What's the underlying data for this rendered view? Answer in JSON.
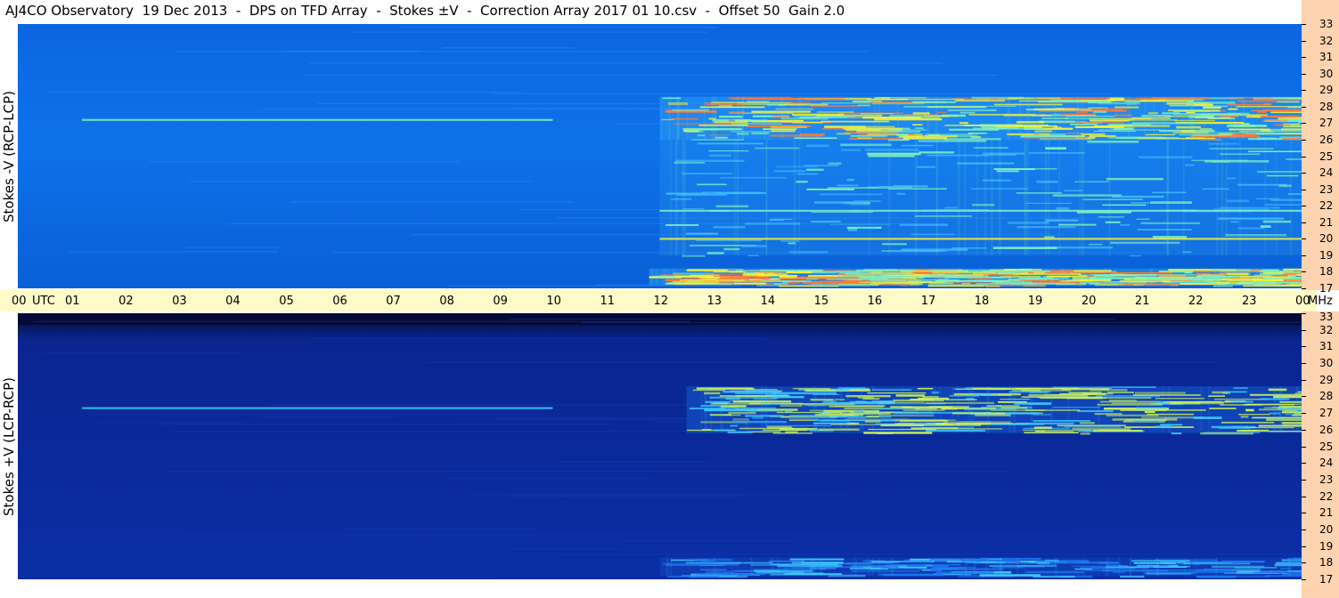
{
  "title": "AJ4CO Observatory  19 Dec 2013  -  DPS on TFD Array  -  Stokes ±V  -  Correction Array 2017 01 10.csv  -  Offset 50  Gain 2.0",
  "chart_data": [
    {
      "type": "heatmap",
      "panel": "top",
      "ylabel": "Stokes -V (RCP-LCP)",
      "x_axis": {
        "unit_labels": [
          "UTC",
          "MHz"
        ],
        "ticks": [
          "00",
          "01",
          "02",
          "03",
          "04",
          "05",
          "06",
          "07",
          "08",
          "09",
          "10",
          "11",
          "12",
          "13",
          "14",
          "15",
          "16",
          "17",
          "18",
          "19",
          "20",
          "21",
          "22",
          "23",
          "00"
        ],
        "range_hours": [
          0,
          24
        ]
      },
      "y_axis": {
        "ticks": [
          "17",
          "18",
          "19",
          "20",
          "21",
          "22",
          "23",
          "24",
          "25",
          "26",
          "27",
          "28",
          "29",
          "30",
          "31",
          "32",
          "33"
        ],
        "range_mhz": [
          17,
          33
        ]
      },
      "colors": {
        "background": "#0a6ae6",
        "emission_low": "#3fb8ff",
        "emission_mid": "#7ef0c0",
        "emission_high": "#f2f23a",
        "hot": "#ff7a3a"
      },
      "features": [
        {
          "kind": "band",
          "utc": [
            12,
            24
          ],
          "mhz": [
            26,
            28.6
          ],
          "level": "high"
        },
        {
          "kind": "band",
          "utc": [
            11.8,
            24
          ],
          "mhz": [
            17.2,
            18.2
          ],
          "level": "high"
        },
        {
          "kind": "band",
          "utc": [
            12,
            24
          ],
          "mhz": [
            19,
            26
          ],
          "level": "mid"
        },
        {
          "kind": "line",
          "utc": [
            12,
            24
          ],
          "mhz": 21.7,
          "level": "mid"
        },
        {
          "kind": "line",
          "utc": [
            12,
            24
          ],
          "mhz": 20.0,
          "level": "high"
        },
        {
          "kind": "line",
          "utc": [
            1.2,
            10
          ],
          "mhz": 27.2,
          "level": "mid"
        }
      ]
    },
    {
      "type": "heatmap",
      "panel": "bottom",
      "ylabel": "Stokes +V (LCP-RCP)",
      "y_axis": {
        "ticks": [
          "17",
          "18",
          "19",
          "20",
          "21",
          "22",
          "23",
          "24",
          "25",
          "26",
          "27",
          "28",
          "29",
          "30",
          "31",
          "32",
          "33"
        ],
        "range_mhz": [
          17,
          33
        ]
      },
      "colors": {
        "background": "#0b2a9a",
        "dark": "#050a35",
        "emission_low": "#1e78f0",
        "emission_mid": "#3ec8ff",
        "emission_high": "#c8f060"
      },
      "features": [
        {
          "kind": "band",
          "utc": [
            12.5,
            24
          ],
          "mhz": [
            25.8,
            28.6
          ],
          "level": "high"
        },
        {
          "kind": "band",
          "utc": [
            0,
            24
          ],
          "mhz": [
            32.3,
            33
          ],
          "level": "dark"
        },
        {
          "kind": "band",
          "utc": [
            12,
            24
          ],
          "mhz": [
            17.2,
            18.3
          ],
          "level": "mid"
        },
        {
          "kind": "line",
          "utc": [
            1.2,
            10
          ],
          "mhz": 27.3,
          "level": "mid"
        }
      ]
    }
  ]
}
